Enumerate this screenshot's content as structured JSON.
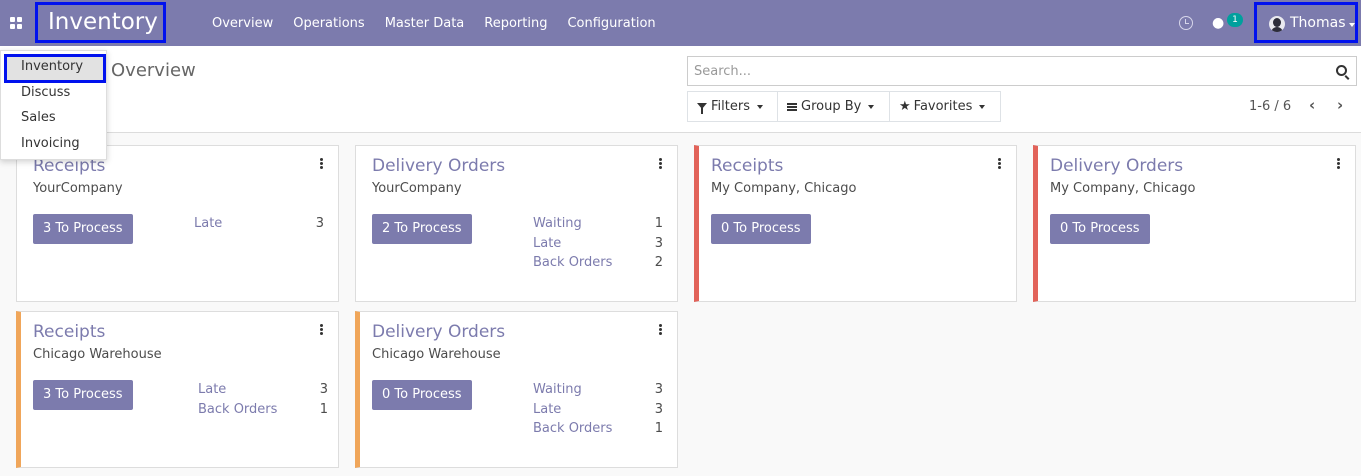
{
  "app": {
    "name": "Inventory"
  },
  "menu": [
    "Overview",
    "Operations",
    "Master Data",
    "Reporting",
    "Configuration"
  ],
  "systray": {
    "chat_count": "1",
    "user_name": "Thomas"
  },
  "breadcrumb": "Overview",
  "search": {
    "placeholder": "Search..."
  },
  "filters": {
    "filters": "Filters",
    "group_by": "Group By",
    "favorites": "Favorites"
  },
  "pager": {
    "text": "1-6 / 6"
  },
  "app_dropdown": [
    "Inventory",
    "Discuss",
    "Sales",
    "Invoicing"
  ],
  "cards": [
    {
      "title": "Receipts",
      "subtitle": "YourCompany",
      "button": "3 To Process",
      "stats": [
        {
          "label": "Late",
          "value": "3"
        }
      ]
    },
    {
      "title": "Delivery Orders",
      "subtitle": "YourCompany",
      "button": "2 To Process",
      "stats": [
        {
          "label": "Waiting",
          "value": "1"
        },
        {
          "label": "Late",
          "value": "3"
        },
        {
          "label": "Back Orders",
          "value": "2"
        }
      ]
    },
    {
      "title": "Receipts",
      "subtitle": "My Company, Chicago",
      "button": "0 To Process",
      "stats": []
    },
    {
      "title": "Delivery Orders",
      "subtitle": "My Company, Chicago",
      "button": "0 To Process",
      "stats": []
    },
    {
      "title": "Receipts",
      "subtitle": "Chicago Warehouse",
      "button": "3 To Process",
      "stats": [
        {
          "label": "Late",
          "value": "3"
        },
        {
          "label": "Back Orders",
          "value": "1"
        }
      ]
    },
    {
      "title": "Delivery Orders",
      "subtitle": "Chicago Warehouse",
      "button": "0 To Process",
      "stats": [
        {
          "label": "Waiting",
          "value": "3"
        },
        {
          "label": "Late",
          "value": "3"
        },
        {
          "label": "Back Orders",
          "value": "1"
        }
      ]
    }
  ],
  "colors": {
    "navbar": "#7c7bad",
    "accent": "#7c7bad",
    "red_bar": "#e2635a",
    "orange_bar": "#f0a65a",
    "badge": "#00a09d"
  }
}
